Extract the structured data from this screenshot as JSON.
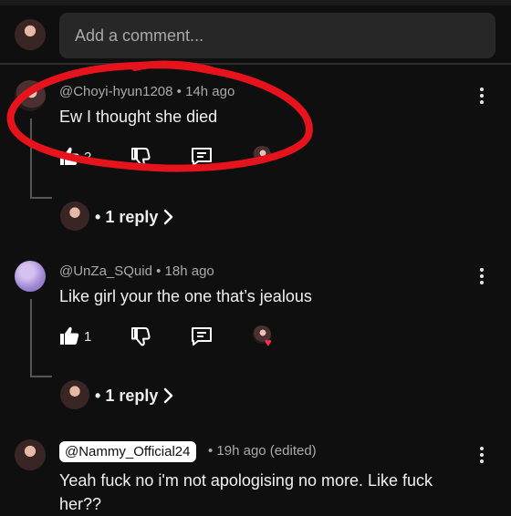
{
  "add_comment": {
    "placeholder": "Add a comment..."
  },
  "comments": [
    {
      "author": "@Choyi-hyun1208",
      "time": "14h ago",
      "text": "Ew I thought she died",
      "likes": "2",
      "reply_label": "1 reply"
    },
    {
      "author": "@UnZa_SQuid",
      "time": "18h ago",
      "text": "Like girl your the one that’s jealous",
      "likes": "1",
      "reply_label": "1 reply"
    },
    {
      "author": "@Nammy_Official24",
      "time": "19h ago (edited)",
      "text_line1": "Yeah fuck no i'm not apologising no more. Like fuck",
      "text_line2": "her??"
    }
  ],
  "icons": {
    "like": "thumbs-up-icon",
    "dislike": "thumbs-down-icon",
    "reply": "comment-icon",
    "more": "more-vert-icon",
    "chevron": "chevron-right-icon",
    "heart": "heart-icon"
  },
  "colors": {
    "bg": "#0f0f0f",
    "annotation": "#e6131d",
    "heart": "#ff2d55"
  }
}
